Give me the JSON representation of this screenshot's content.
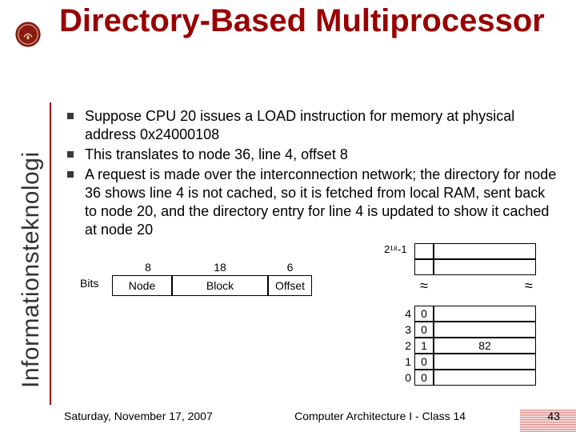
{
  "title": "Directory-Based Multiprocessor",
  "sidebar_label": "Informationsteknologi",
  "logo_alt": "Uppsala Universitet",
  "bullets": [
    "Suppose CPU 20 issues a LOAD instruction for memory at physical address 0x24000108",
    "This translates to node 36, line 4, offset 8",
    "A request is made over the interconnection network; the directory for node 36 shows line 4 is not cached, so it is fetched from local RAM, sent back to node 20, and the directory entry for line 4 is updated to show it cached at node 20"
  ],
  "address_fields": {
    "bits_label": "Bits",
    "widths": [
      "8",
      "18",
      "6"
    ],
    "labels": [
      "Node",
      "Block",
      "Offset"
    ]
  },
  "directory": {
    "top_label": "2¹⁸-1",
    "rows": [
      {
        "index": "4",
        "valid": "0",
        "node": ""
      },
      {
        "index": "3",
        "valid": "0",
        "node": ""
      },
      {
        "index": "2",
        "valid": "1",
        "node": "82"
      },
      {
        "index": "1",
        "valid": "0",
        "node": ""
      },
      {
        "index": "0",
        "valid": "0",
        "node": ""
      }
    ]
  },
  "footer": {
    "date": "Saturday, November 17, 2007",
    "course": "Computer Architecture I - Class 14",
    "page": "43"
  }
}
